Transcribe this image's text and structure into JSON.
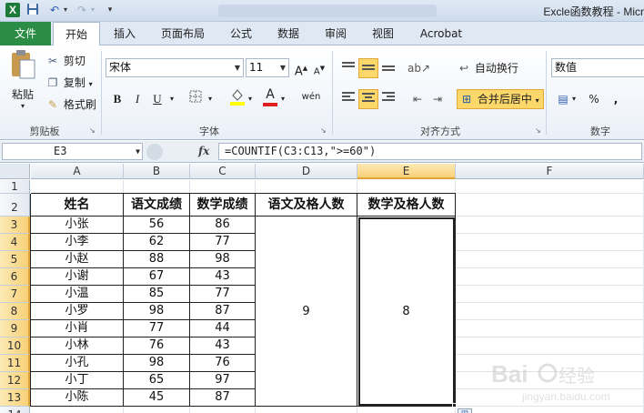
{
  "titlebar": {
    "window_title": "Excle函数教程 - Micr",
    "logo_text": "X"
  },
  "ribbon_tabs": [
    "文件",
    "开始",
    "插入",
    "页面布局",
    "公式",
    "数据",
    "审阅",
    "视图",
    "Acrobat"
  ],
  "clipboard": {
    "paste": "粘贴",
    "cut": "剪切",
    "copy": "复制",
    "format_painter": "格式刷",
    "group_label": "剪贴板"
  },
  "font": {
    "name": "宋体",
    "size": "11",
    "bold": "B",
    "italic": "I",
    "underline": "U",
    "grow": "A",
    "shrink": "A",
    "font_color_glyph": "A",
    "phonetic": "wén",
    "group_label": "字体"
  },
  "alignment": {
    "wrap_text": "自动换行",
    "merge_center": "合并后居中",
    "group_label": "对齐方式"
  },
  "number": {
    "format": "数值",
    "percent": "%",
    "comma": ",",
    "group_label": "数字"
  },
  "formula_bar": {
    "name_box": "E3",
    "fx": "fx",
    "formula": "=COUNTIF(C3:C13,\">=60\")"
  },
  "sheet": {
    "columns": [
      "A",
      "B",
      "C",
      "D",
      "E",
      "F"
    ],
    "rows": [
      "1",
      "2",
      "3",
      "4",
      "5",
      "6",
      "7",
      "8",
      "9",
      "10",
      "11",
      "12",
      "13",
      "14"
    ],
    "headers": [
      "姓名",
      "语文成绩",
      "数学成绩",
      "语文及格人数",
      "数学及格人数"
    ],
    "data": [
      [
        "小张",
        "56",
        "86"
      ],
      [
        "小李",
        "62",
        "77"
      ],
      [
        "小赵",
        "88",
        "98"
      ],
      [
        "小谢",
        "67",
        "43"
      ],
      [
        "小温",
        "85",
        "77"
      ],
      [
        "小罗",
        "98",
        "87"
      ],
      [
        "小肖",
        "77",
        "44"
      ],
      [
        "小林",
        "76",
        "43"
      ],
      [
        "小孔",
        "98",
        "76"
      ],
      [
        "小丁",
        "65",
        "97"
      ],
      [
        "小陈",
        "45",
        "87"
      ]
    ],
    "chinese_pass_count": "9",
    "math_pass_count": "8"
  },
  "watermark": {
    "brand": "Baidu经验",
    "url": "jingyan.baidu.com"
  },
  "colors": {
    "file_tab": "#2a8c45",
    "selection_header": "#f7d177",
    "highlight_button": "#fcd86a"
  }
}
